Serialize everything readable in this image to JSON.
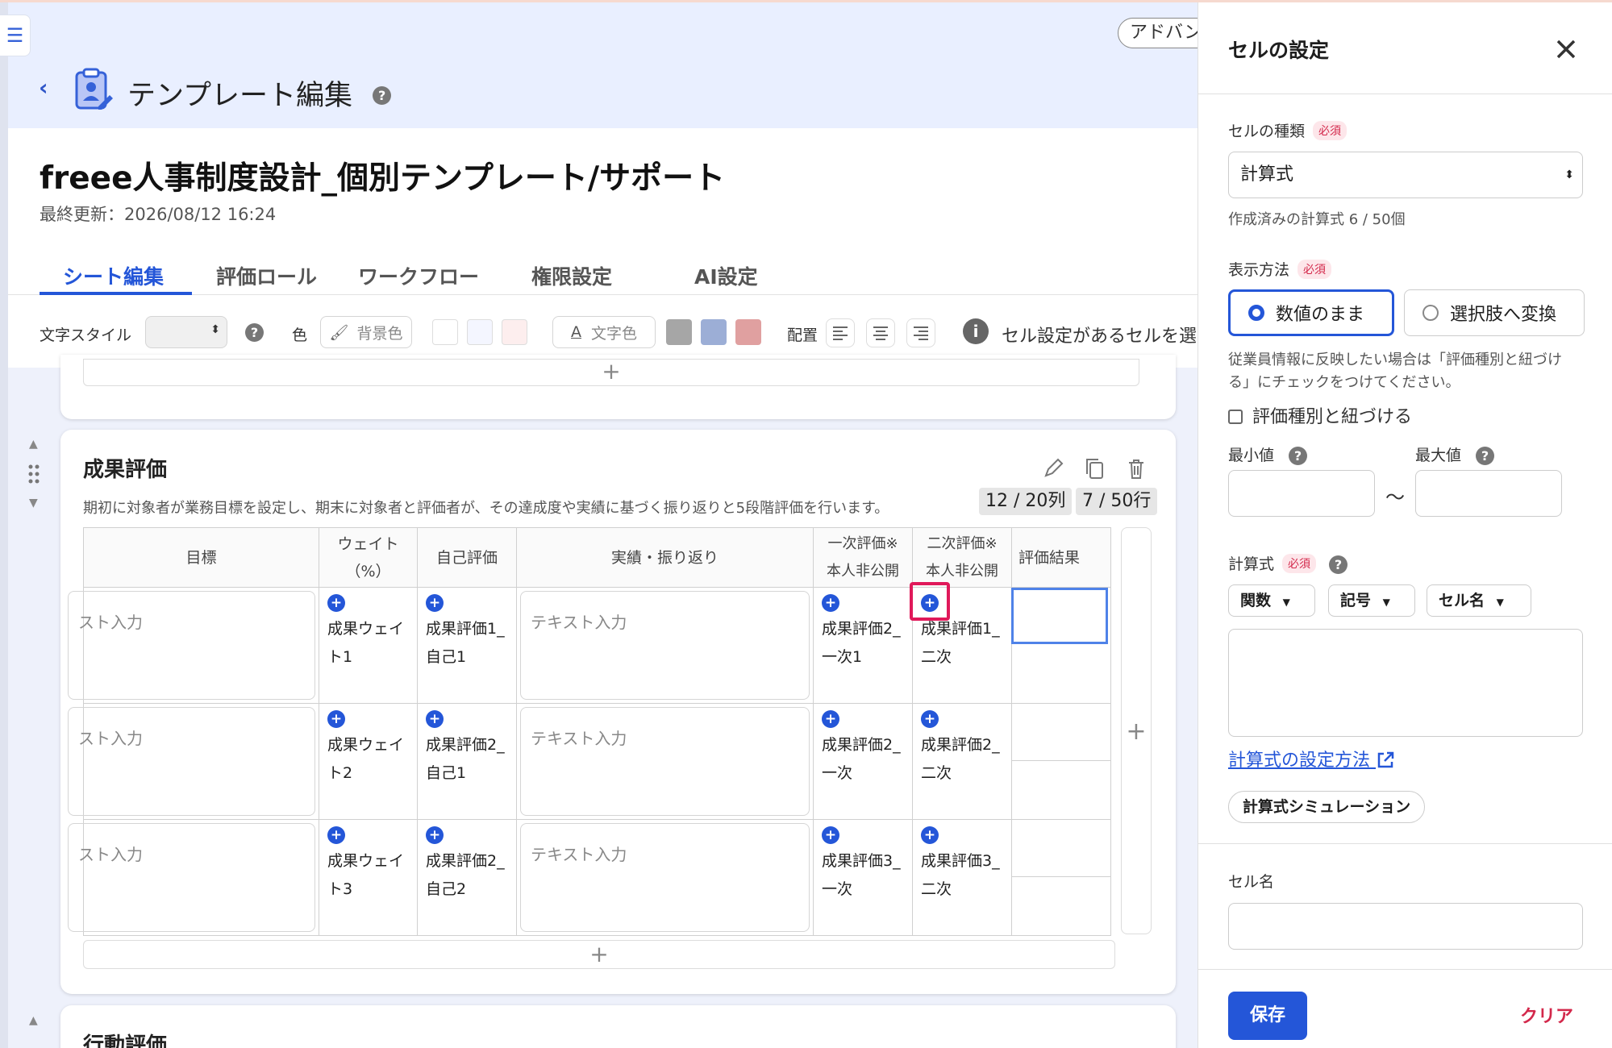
{
  "page": {
    "title": "テンプレート編集",
    "advanced_label": "アドバン",
    "help": "?"
  },
  "doc": {
    "title": "freee人事制度設計_個別テンプレート/サポート",
    "updated": "最終更新：2026/08/12 16:24"
  },
  "tabs": [
    {
      "label": "シート編集"
    },
    {
      "label": "評価ロール"
    },
    {
      "label": "ワークフロー"
    },
    {
      "label": "権限設定"
    },
    {
      "label": "AI設定"
    }
  ],
  "toolbar": {
    "text_style": "文字スタイル",
    "color": "色",
    "bg_color": "背景色",
    "text_color": "文字色",
    "align": "配置",
    "notice": "セル設定があるセルを選",
    "bg_swatches": [
      "#ffffff",
      "#f4f6ff",
      "#fdeeee"
    ],
    "text_swatches": [
      "#a6a6a6",
      "#9caed6",
      "#e0a0a0"
    ]
  },
  "section": {
    "title": "成果評価",
    "desc": "期初に対象者が業務目標を設定し、期末に対象者と評価者が、その達成度や実績に基づく振り返りと5段階評価を行います。",
    "cols_badge": "12 / 20列",
    "rows_badge": "7 / 50行",
    "headers": [
      {
        "l1": "目標",
        "l2": ""
      },
      {
        "l1": "ウェイト",
        "l2": "（%）"
      },
      {
        "l1": "自己評価",
        "l2": ""
      },
      {
        "l1": "実績・振り返り",
        "l2": ""
      },
      {
        "l1": "一次評価※",
        "l2": "本人非公開"
      },
      {
        "l1": "二次評価※",
        "l2": "本人非公開"
      },
      {
        "l1": "評価結果",
        "l2": ""
      }
    ],
    "rows": [
      {
        "goal": "スト入力",
        "weight": "成果ウェイト1",
        "self": "成果評価1_自己1",
        "review": "テキスト入力",
        "first": "成果評価2_一次1",
        "second": "成果評価1_二次"
      },
      {
        "goal": "スト入力",
        "weight": "成果ウェイト2",
        "self": "成果評価2_自己1",
        "review": "テキスト入力",
        "first": "成果評価2_一次",
        "second": "成果評価2_二次"
      },
      {
        "goal": "スト入力",
        "weight": "成果ウェイト3",
        "self": "成果評価2_自己2",
        "review": "テキスト入力",
        "first": "成果評価3_一次",
        "second": "成果評価3_二次"
      }
    ]
  },
  "next_section": {
    "title": "行動評価"
  },
  "panel": {
    "title": "セルの設定",
    "cell_type_label": "セルの種類",
    "required": "必須",
    "cell_type_value": "計算式",
    "formula_count": "作成済みの計算式 6 / 50個",
    "display_label": "表示方法",
    "radio_as_is": "数値のまま",
    "radio_convert": "選択肢へ変換",
    "display_note": "従業員情報に反映したい場合は「評価種別と紐づける」にチェックをつけてください。",
    "link_checkbox": "評価種別と紐づける",
    "min_label": "最小値",
    "max_label": "最大値",
    "tilde": "〜",
    "formula_label": "計算式",
    "dd_func": "関数",
    "dd_symbol": "記号",
    "dd_cellname": "セル名",
    "formula_help_link": "計算式の設定方法",
    "simulation": "計算式シミュレーション",
    "cell_name_label": "セル名",
    "save": "保存",
    "clear": "クリア"
  }
}
